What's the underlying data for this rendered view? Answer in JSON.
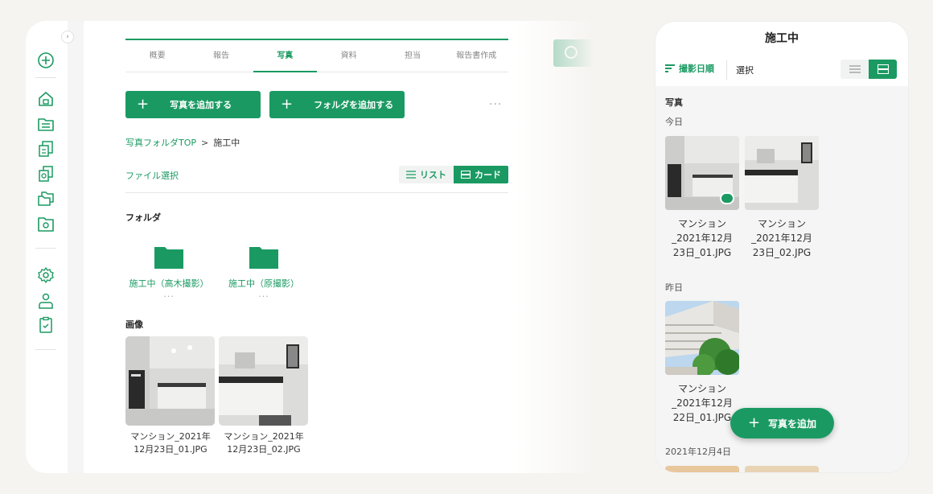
{
  "desktop": {
    "tabs": [
      {
        "label": "概要"
      },
      {
        "label": "報告"
      },
      {
        "label": "写真"
      },
      {
        "label": "資料"
      },
      {
        "label": "担当"
      },
      {
        "label": "報告書作成"
      }
    ],
    "add_photo_label": "写真を追加する",
    "add_folder_label": "フォルダを追加する",
    "more": "···",
    "breadcrumb": {
      "root": "写真フォルダTOP",
      "separator": ">",
      "current": "施工中"
    },
    "file_select": "ファイル選択",
    "view_toggle": {
      "list": "リスト",
      "card": "カード",
      "active": "card"
    },
    "folder_section": "フォルダ",
    "folders": [
      {
        "name": "施工中（高木撮影）",
        "more": "···"
      },
      {
        "name": "施工中（原撮影）",
        "more": "···"
      }
    ],
    "image_section": "画像",
    "images": [
      {
        "caption_1": "マンション_2021年",
        "caption_2": "12月23日_01.JPG"
      },
      {
        "caption_1": "マンション_2021年",
        "caption_2": "12月23日_02.JPG"
      }
    ],
    "accent": "#1a9a62"
  },
  "mobile": {
    "title": "施工中",
    "sort_label": "撮影日順",
    "select_label": "選択",
    "section": "写真",
    "groups": [
      {
        "label": "今日"
      },
      {
        "label": "昨日"
      },
      {
        "label": "2021年12月4日"
      }
    ],
    "today_photos": [
      {
        "line1": "マンション",
        "line2": "_2021年12月",
        "line3": "23日_01.JPG"
      },
      {
        "line1": "マンション",
        "line2": "_2021年12月",
        "line3": "23日_02.JPG"
      }
    ],
    "yesterday_photos": [
      {
        "line1": "マンション",
        "line2": "_2021年12月",
        "line3": "22日_01.JPG"
      }
    ],
    "fab_label": "写真を追加"
  }
}
